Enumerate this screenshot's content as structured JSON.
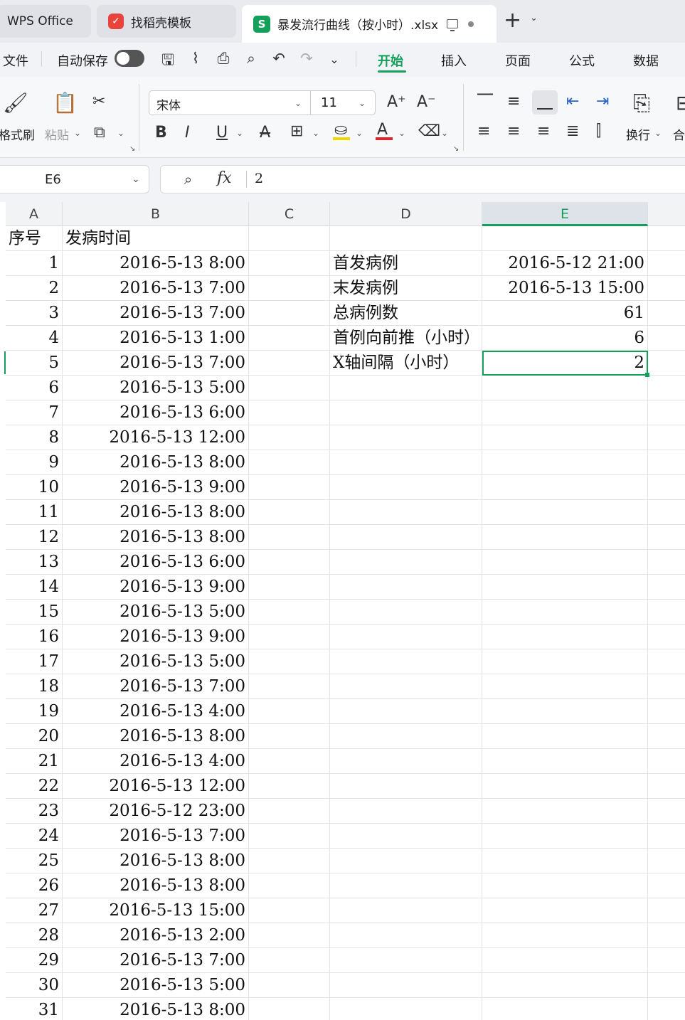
{
  "tabs": {
    "wps": "WPS Office",
    "template": "找稻壳模板",
    "active_file": "暴发流行曲线（按小时）.xlsx"
  },
  "menu": {
    "file": "文件",
    "autosave": "自动保存",
    "items": [
      "开始",
      "插入",
      "页面",
      "公式",
      "数据"
    ]
  },
  "ribbon": {
    "format_painter": "格式刷",
    "paste": "粘贴",
    "font_name": "宋体",
    "font_size": "11",
    "wrap": "换行",
    "merge": "合"
  },
  "formula_bar": {
    "cell_ref": "E6",
    "fx": "fx",
    "value": "2"
  },
  "columns": [
    "A",
    "B",
    "C",
    "D",
    "E"
  ],
  "selected_column": "E",
  "headers": {
    "a": "序号",
    "b": "发病时间"
  },
  "rows": [
    {
      "n": "1",
      "t": "2016-5-13  8:00"
    },
    {
      "n": "2",
      "t": "2016-5-13  7:00"
    },
    {
      "n": "3",
      "t": "2016-5-13  7:00"
    },
    {
      "n": "4",
      "t": "2016-5-13  1:00"
    },
    {
      "n": "5",
      "t": "2016-5-13  7:00"
    },
    {
      "n": "6",
      "t": "2016-5-13  5:00"
    },
    {
      "n": "7",
      "t": "2016-5-13  6:00"
    },
    {
      "n": "8",
      "t": "2016-5-13  12:00"
    },
    {
      "n": "9",
      "t": "2016-5-13  8:00"
    },
    {
      "n": "10",
      "t": "2016-5-13  9:00"
    },
    {
      "n": "11",
      "t": "2016-5-13  8:00"
    },
    {
      "n": "12",
      "t": "2016-5-13  8:00"
    },
    {
      "n": "13",
      "t": "2016-5-13  6:00"
    },
    {
      "n": "14",
      "t": "2016-5-13  9:00"
    },
    {
      "n": "15",
      "t": "2016-5-13  5:00"
    },
    {
      "n": "16",
      "t": "2016-5-13  9:00"
    },
    {
      "n": "17",
      "t": "2016-5-13  5:00"
    },
    {
      "n": "18",
      "t": "2016-5-13  7:00"
    },
    {
      "n": "19",
      "t": "2016-5-13  4:00"
    },
    {
      "n": "20",
      "t": "2016-5-13  8:00"
    },
    {
      "n": "21",
      "t": "2016-5-13  4:00"
    },
    {
      "n": "22",
      "t": "2016-5-13  12:00"
    },
    {
      "n": "23",
      "t": "2016-5-12  23:00"
    },
    {
      "n": "24",
      "t": "2016-5-13  7:00"
    },
    {
      "n": "25",
      "t": "2016-5-13  8:00"
    },
    {
      "n": "26",
      "t": "2016-5-13  8:00"
    },
    {
      "n": "27",
      "t": "2016-5-13  15:00"
    },
    {
      "n": "28",
      "t": "2016-5-13  2:00"
    },
    {
      "n": "29",
      "t": "2016-5-13  7:00"
    },
    {
      "n": "30",
      "t": "2016-5-13  5:00"
    },
    {
      "n": "31",
      "t": "2016-5-13  8:00"
    }
  ],
  "summary": [
    {
      "label": "首发病例",
      "value": "2016-5-12  21:00"
    },
    {
      "label": "末发病例",
      "value": "2016-5-13  15:00"
    },
    {
      "label": "总病例数",
      "value": "61"
    },
    {
      "label": "首例向前推（小时）",
      "value": "6"
    },
    {
      "label": "X轴间隔（小时）",
      "value": "2"
    }
  ],
  "accent_color": "#14a05a"
}
